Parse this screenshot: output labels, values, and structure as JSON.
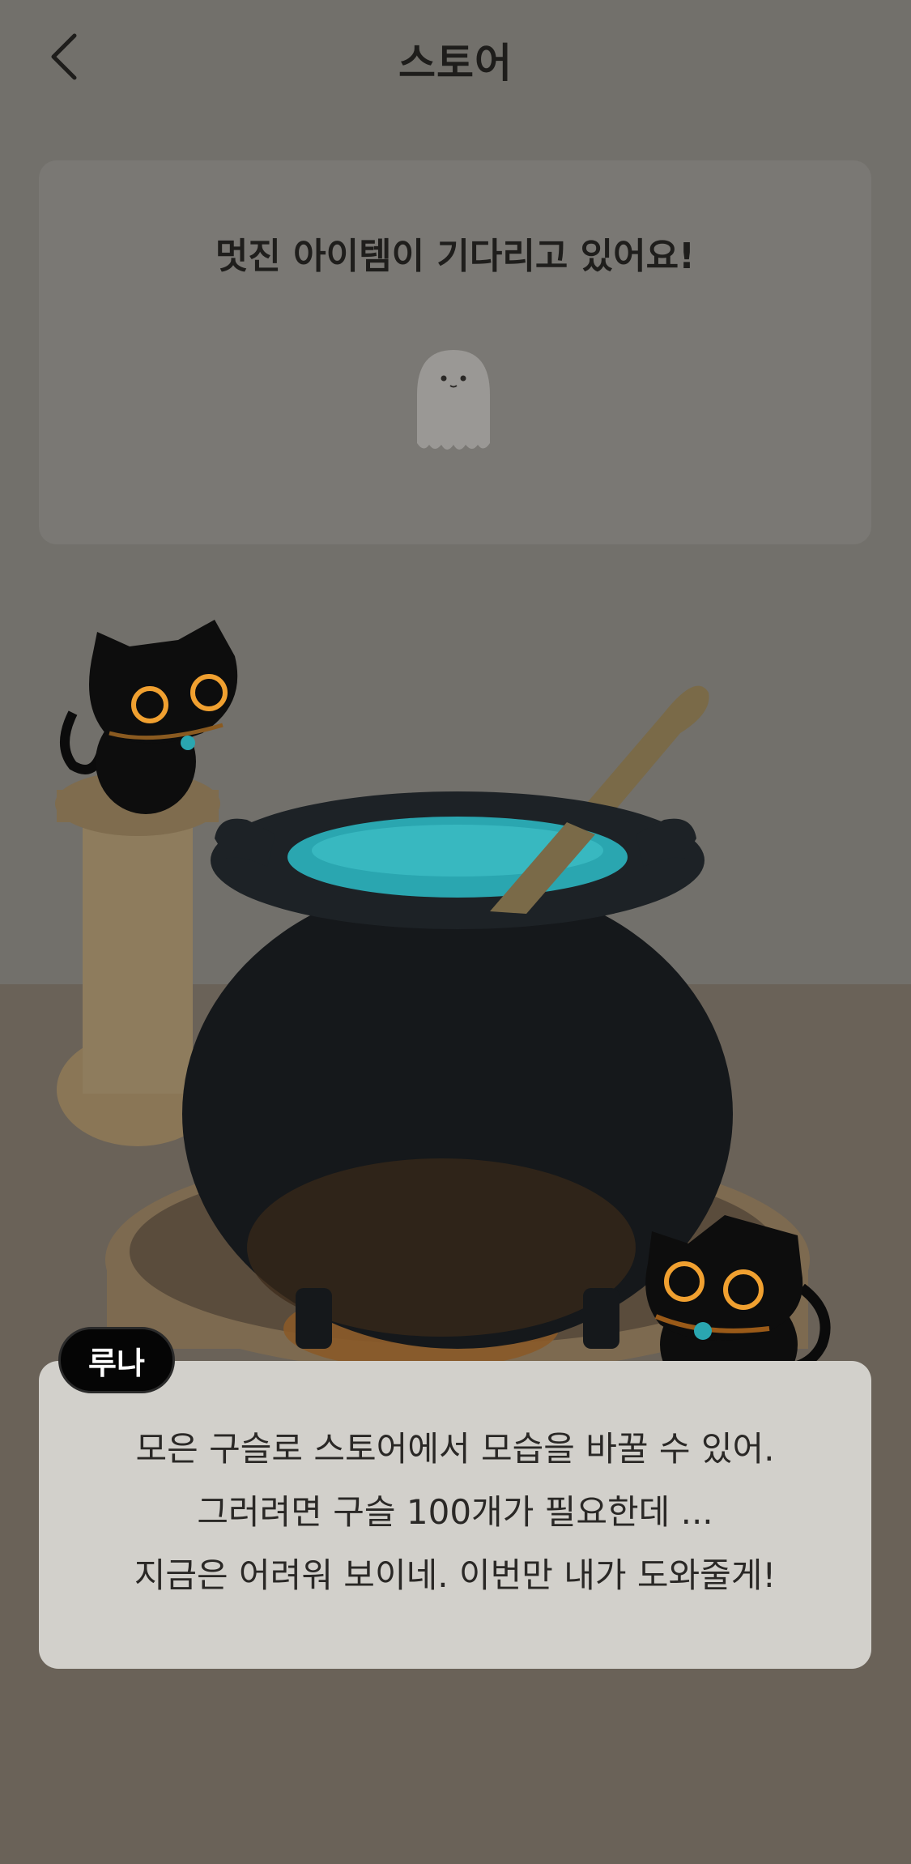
{
  "header": {
    "title": "스토어",
    "back_icon": "chevron-left-icon"
  },
  "item_card": {
    "message": "멋진 아이템이 기다리고 있어요!",
    "icon": "ghost-icon"
  },
  "dialog": {
    "speaker": "루나",
    "lines": [
      "모은 구슬로 스토어에서 모습을 바꿀 수 있어.",
      "그러려면 구슬 100개가 필요한데 ...",
      "지금은 어려워 보이네. 이번만 내가 도와줄게!"
    ]
  },
  "colors": {
    "overlay": "#6f6c66",
    "cauldron_liquid": "#2aa6b0",
    "cat_eye": "#f0a030",
    "dialog_bg": "#d2d0cb"
  }
}
